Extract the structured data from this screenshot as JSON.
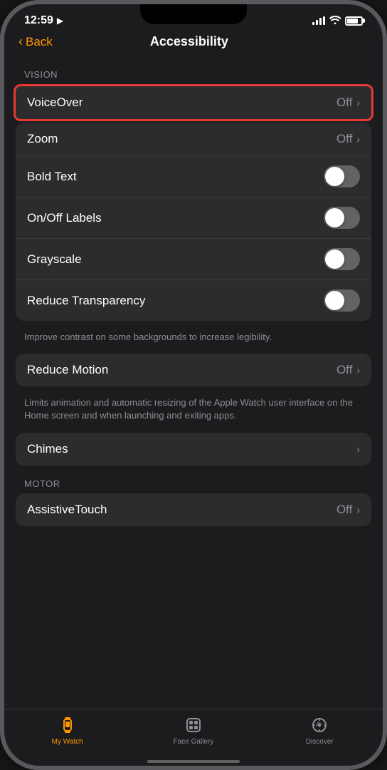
{
  "status": {
    "time": "12:59",
    "location_icon": "▶"
  },
  "nav": {
    "back_label": "Back",
    "title": "Accessibility"
  },
  "vision_section": {
    "header": "VISION",
    "items": [
      {
        "id": "voiceover",
        "label": "VoiceOver",
        "value": "Off",
        "type": "nav",
        "highlighted": true
      },
      {
        "id": "zoom",
        "label": "Zoom",
        "value": "Off",
        "type": "nav"
      },
      {
        "id": "bold-text",
        "label": "Bold Text",
        "type": "toggle",
        "enabled": true
      },
      {
        "id": "onoff-labels",
        "label": "On/Off Labels",
        "type": "toggle",
        "enabled": true
      },
      {
        "id": "grayscale",
        "label": "Grayscale",
        "type": "toggle",
        "enabled": true
      },
      {
        "id": "reduce-transparency",
        "label": "Reduce Transparency",
        "type": "toggle",
        "enabled": true
      }
    ],
    "description": "Improve contrast on some backgrounds to increase legibility."
  },
  "motion_section": {
    "items": [
      {
        "id": "reduce-motion",
        "label": "Reduce Motion",
        "value": "Off",
        "type": "nav"
      }
    ],
    "description": "Limits animation and automatic resizing of the Apple Watch user interface on the Home screen and when launching and exiting apps."
  },
  "chimes_section": {
    "items": [
      {
        "id": "chimes",
        "label": "Chimes",
        "type": "nav"
      }
    ]
  },
  "motor_section": {
    "header": "MOTOR",
    "items": [
      {
        "id": "assistive-touch",
        "label": "AssistiveTouch",
        "value": "Off",
        "type": "nav"
      }
    ]
  },
  "tab_bar": {
    "items": [
      {
        "id": "my-watch",
        "label": "My Watch",
        "active": true
      },
      {
        "id": "face-gallery",
        "label": "Face Gallery",
        "active": false
      },
      {
        "id": "discover",
        "label": "Discover",
        "active": false
      }
    ]
  }
}
